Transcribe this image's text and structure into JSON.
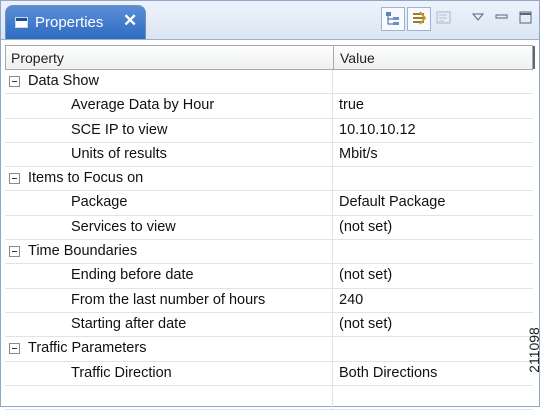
{
  "view": {
    "tab_title": "Properties",
    "tab_close": "✕",
    "toolbar": {
      "icons": [
        "show-categories-icon",
        "show-advanced-icon",
        "restore-defaults-icon",
        "view-menu-icon",
        "minimize-icon",
        "maximize-icon"
      ]
    }
  },
  "table": {
    "columns": [
      "Property",
      "Value"
    ],
    "rows": [
      {
        "type": "category",
        "label": "Data Show",
        "value": ""
      },
      {
        "type": "property",
        "label": "Average Data by Hour",
        "value": "true"
      },
      {
        "type": "property",
        "label": "SCE IP to view",
        "value": "10.10.10.12"
      },
      {
        "type": "property",
        "label": "Units of results",
        "value": "Mbit/s"
      },
      {
        "type": "category",
        "label": "Items to Focus on",
        "value": ""
      },
      {
        "type": "property",
        "label": "Package",
        "value": "Default Package"
      },
      {
        "type": "property",
        "label": "Services to view",
        "value": "(not set)"
      },
      {
        "type": "category",
        "label": "Time Boundaries",
        "value": ""
      },
      {
        "type": "property",
        "label": "Ending before date",
        "value": "(not set)"
      },
      {
        "type": "property",
        "label": "From the last number of hours",
        "value": "240"
      },
      {
        "type": "property",
        "label": "Starting after date",
        "value": "(not set)"
      },
      {
        "type": "category",
        "label": "Traffic Parameters",
        "value": ""
      },
      {
        "type": "property",
        "label": "Traffic Direction",
        "value": "Both Directions"
      },
      {
        "type": "empty",
        "label": "",
        "value": ""
      }
    ]
  },
  "figure_code": "211098"
}
